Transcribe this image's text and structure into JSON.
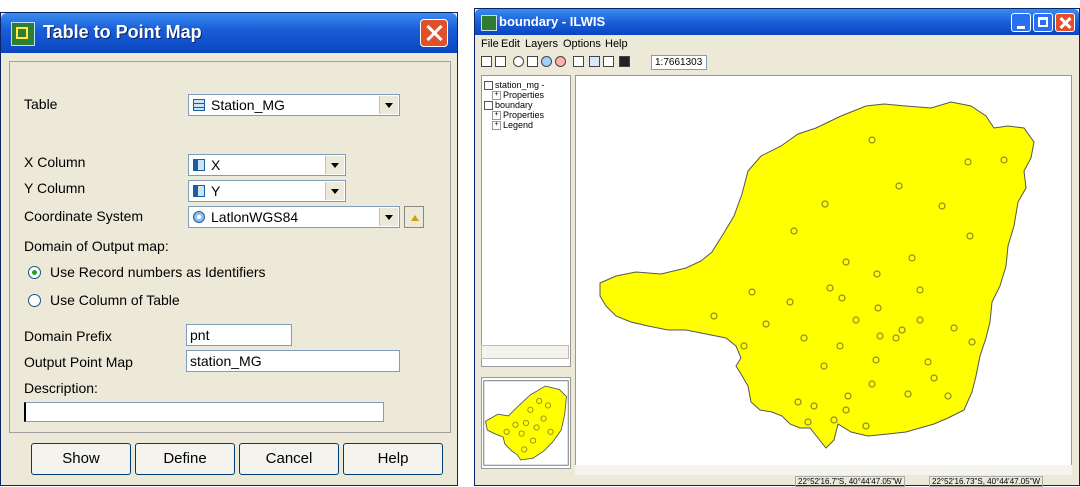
{
  "dialog": {
    "title": "Table to Point Map",
    "table_label": "Table",
    "table_value": "Station_MG",
    "x_label": "X Column",
    "x_value": "X",
    "y_label": "Y Column",
    "y_value": "Y",
    "cs_label": "Coordinate System",
    "cs_value": "LatlonWGS84",
    "domain_heading": "Domain of Output map:",
    "radio_record": "Use Record numbers as Identifiers",
    "radio_record_selected": true,
    "radio_column": "Use Column of Table",
    "prefix_label": "Domain Prefix",
    "prefix_value": "pnt",
    "output_label": "Output Point Map",
    "output_value": "station_MG",
    "desc_label": "Description:",
    "desc_value": "",
    "buttons": {
      "show": "Show",
      "define": "Define",
      "cancel": "Cancel",
      "help": "Help"
    }
  },
  "window": {
    "title": "boundary - ILWIS",
    "menu": [
      "File",
      "Edit",
      "Layers",
      "Options",
      "Help"
    ],
    "scale": "1:7661303",
    "layers": [
      {
        "label": "station_mg -"
      },
      {
        "label": "Properties"
      },
      {
        "label": "boundary"
      },
      {
        "label": "Properties"
      },
      {
        "label": "Legend"
      }
    ],
    "status_coords_1": "22°52'16.7\"S, 40°44'47.05\"W",
    "status_coords_2": "22°52'16.73\"S, 40°44'47.05\"W",
    "colors": {
      "map_fill": "#ffff00",
      "map_outline": "#555555",
      "station": "#8a8a2a"
    },
    "station_count": 43
  }
}
